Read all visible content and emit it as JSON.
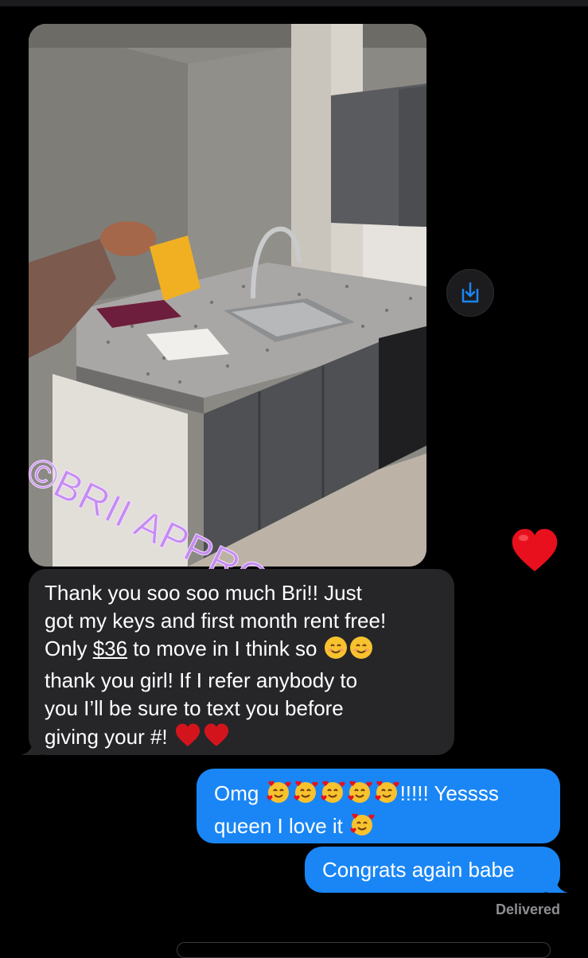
{
  "photo_message": {
    "watermark": "©BRII APPROVALS",
    "reaction": "red-heart"
  },
  "save_button": {
    "icon": "save-download-icon",
    "color": "#1a86f5"
  },
  "incoming_message": {
    "line1": "Thank you soo soo much Bri!! Just",
    "line2": "got my keys and first month rent free!",
    "line3_prefix": "Only ",
    "line3_amount": "$36",
    "line3_suffix": " to move in I think so",
    "line4": "thank you girl! If I refer anybody to",
    "line5": "you I’ll be sure to text you before",
    "line6": "giving your #!"
  },
  "outgoing_messages": [
    {
      "line1_prefix": "Omg",
      "line1_suffix": "!!!!! Yessss",
      "line2": "queen I love it"
    },
    {
      "text": "Congrats again babe"
    }
  ],
  "status": {
    "delivered": "Delivered"
  },
  "colors": {
    "incoming_bubble": "#262629",
    "outgoing_bubble": "#1a86f5",
    "background": "#000000"
  }
}
